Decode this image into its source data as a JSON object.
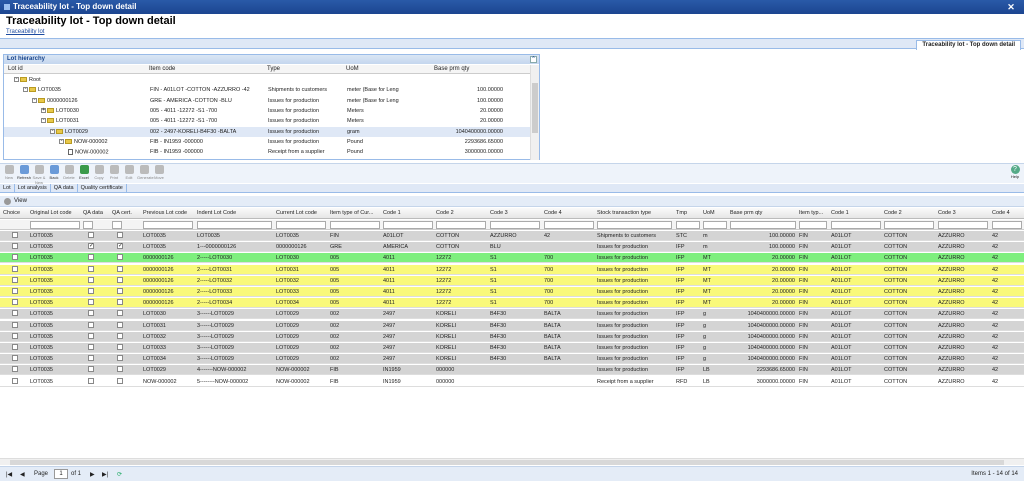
{
  "window": {
    "title": "Traceability lot - Top down detail"
  },
  "page": {
    "title": "Traceability lot - Top down detail",
    "breadcrumb": "Traceability lot",
    "tab": "Traceability lot - Top down detail"
  },
  "lot_hierarchy": {
    "title": "Lot hierarchy",
    "columns": [
      "Lot id",
      "Item code",
      "Type",
      "UoM",
      "Base prm qty"
    ],
    "rows": [
      {
        "indent": 0,
        "expander": "-",
        "kind": "folder",
        "lot": "Root",
        "item": "",
        "type": "",
        "uom": "",
        "qty": ""
      },
      {
        "indent": 1,
        "expander": "-",
        "kind": "folder",
        "lot": "LOT0035",
        "item": "FIN - A01LOT -COTTON -AZZURRO -42",
        "type": "Shipments to customers",
        "uom": "meter (Base for Leng",
        "qty": "100.00000"
      },
      {
        "indent": 2,
        "expander": "-",
        "kind": "folder",
        "lot": "0000000126",
        "item": "GRE - AMERICA -COTTON -BLU",
        "type": "Issues for production",
        "uom": "meter (Base for Leng",
        "qty": "100.00000"
      },
      {
        "indent": 3,
        "expander": "+",
        "kind": "folder",
        "lot": "LOT0030",
        "item": "005 - 4011 -12272 -S1 -700",
        "type": "Issues for production",
        "uom": "Meters",
        "qty": "20.00000"
      },
      {
        "indent": 3,
        "expander": "-",
        "kind": "folder",
        "lot": "LOT0031",
        "item": "005 - 4011 -12272 -S1 -700",
        "type": "Issues for production",
        "uom": "Meters",
        "qty": "20.00000"
      },
      {
        "indent": 4,
        "expander": "-",
        "kind": "folder",
        "lot": "LOT0029",
        "item": "002 - 2497-KORELI-B4F30 -BALTA",
        "type": "Issues for production",
        "uom": "gram",
        "qty": "1040400000.00000",
        "selected": true
      },
      {
        "indent": 5,
        "expander": "-",
        "kind": "folder",
        "lot": "NOW-000002",
        "item": "FIB - IN1959 -000000",
        "type": "Issues for production",
        "uom": "Pound",
        "qty": "2293686.65000"
      },
      {
        "indent": 6,
        "expander": "",
        "kind": "doc",
        "lot": "NOW-000002",
        "item": "FIB - IN1959 -000000",
        "type": "Receipt from a supplier",
        "uom": "Pound",
        "qty": "3000000.00000"
      }
    ]
  },
  "toolbar": {
    "buttons": [
      {
        "label": "New",
        "icon": "new-icon",
        "enabled": false
      },
      {
        "label": "Refresh",
        "icon": "refresh-icon",
        "enabled": true
      },
      {
        "label": "Save & New",
        "icon": "save-new-icon",
        "enabled": false
      },
      {
        "label": "Back",
        "icon": "back-icon",
        "enabled": true
      },
      {
        "label": "Delete",
        "icon": "delete-icon",
        "enabled": false
      },
      {
        "label": "Excel",
        "icon": "excel-icon",
        "enabled": true
      },
      {
        "label": "Copy",
        "icon": "copy-icon",
        "enabled": false
      },
      {
        "label": "Print",
        "icon": "print-icon",
        "enabled": false
      },
      {
        "label": "Edit",
        "icon": "edit-icon",
        "enabled": false
      },
      {
        "label": "Generate",
        "icon": "generate-icon",
        "enabled": false
      },
      {
        "label": "Move",
        "icon": "move-icon",
        "enabled": false
      }
    ],
    "help": "Help"
  },
  "subtabs": [
    "Lot",
    "Lot analysis",
    "QA data",
    "Quality certificate"
  ],
  "viewbar": {
    "label": "View"
  },
  "grid": {
    "columns": [
      "Choice",
      "Original Lot code",
      "QA data",
      "QA cert.",
      "Previous Lot code",
      "Indent Lot Code",
      "Current Lot code",
      "Item type of Cur...",
      "Code 1",
      "Code 2",
      "Code 3",
      "Code 4",
      "Stock transaction type",
      "Tmp",
      "UoM",
      "Base prm qty",
      "Item typ...",
      "Code 1",
      "Code 2",
      "Code 3",
      "Code 4"
    ],
    "rows": [
      {
        "color": "gray",
        "qa": false,
        "cert": false,
        "orig": "LOT0035",
        "prev": "LOT0035",
        "indent": "LOT0035",
        "cur": "LOT0035",
        "itype": "FIN",
        "c1": "A01LOT",
        "c2": "COTTON",
        "c3": "AZZURRO",
        "c4": "42",
        "stt": "Shipments to customers",
        "tmp": "STC",
        "uom": "m",
        "qty": "100.00000",
        "it2": "FIN",
        "d1": "A01LOT",
        "d2": "COTTON",
        "d3": "AZZURRO",
        "d4": "42"
      },
      {
        "color": "gray",
        "qa": true,
        "cert": true,
        "orig": "LOT0035",
        "prev": "LOT0035",
        "indent": "1---0000000126",
        "cur": "0000000126",
        "itype": "GRE",
        "c1": "AMERICA",
        "c2": "COTTON",
        "c3": "BLU",
        "c4": "",
        "stt": "Issues for production",
        "tmp": "IFP",
        "uom": "m",
        "qty": "100.00000",
        "it2": "FIN",
        "d1": "A01LOT",
        "d2": "COTTON",
        "d3": "AZZURRO",
        "d4": "42"
      },
      {
        "color": "green",
        "qa": false,
        "cert": false,
        "orig": "LOT0035",
        "prev": "0000000126",
        "indent": "2-----LOT0030",
        "cur": "LOT0030",
        "itype": "005",
        "c1": "4011",
        "c2": "12272",
        "c3": "S1",
        "c4": "700",
        "stt": "Issues for production",
        "tmp": "IFP",
        "uom": "MT",
        "qty": "20.00000",
        "it2": "FIN",
        "d1": "A01LOT",
        "d2": "COTTON",
        "d3": "AZZURRO",
        "d4": "42"
      },
      {
        "color": "yellow",
        "qa": false,
        "cert": false,
        "orig": "LOT0035",
        "prev": "0000000126",
        "indent": "2-----LOT0031",
        "cur": "LOT0031",
        "itype": "005",
        "c1": "4011",
        "c2": "12272",
        "c3": "S1",
        "c4": "700",
        "stt": "Issues for production",
        "tmp": "IFP",
        "uom": "MT",
        "qty": "20.00000",
        "it2": "FIN",
        "d1": "A01LOT",
        "d2": "COTTON",
        "d3": "AZZURRO",
        "d4": "42"
      },
      {
        "color": "yellow",
        "qa": false,
        "cert": false,
        "orig": "LOT0035",
        "prev": "0000000126",
        "indent": "2-----LOT0032",
        "cur": "LOT0032",
        "itype": "005",
        "c1": "4011",
        "c2": "12272",
        "c3": "S1",
        "c4": "700",
        "stt": "Issues for production",
        "tmp": "IFP",
        "uom": "MT",
        "qty": "20.00000",
        "it2": "FIN",
        "d1": "A01LOT",
        "d2": "COTTON",
        "d3": "AZZURRO",
        "d4": "42"
      },
      {
        "color": "yellow",
        "qa": false,
        "cert": false,
        "orig": "LOT0035",
        "prev": "0000000126",
        "indent": "2-----LOT0033",
        "cur": "LOT0033",
        "itype": "005",
        "c1": "4011",
        "c2": "12272",
        "c3": "S1",
        "c4": "700",
        "stt": "Issues for production",
        "tmp": "IFP",
        "uom": "MT",
        "qty": "20.00000",
        "it2": "FIN",
        "d1": "A01LOT",
        "d2": "COTTON",
        "d3": "AZZURRO",
        "d4": "42"
      },
      {
        "color": "yellow",
        "qa": false,
        "cert": false,
        "orig": "LOT0035",
        "prev": "0000000126",
        "indent": "2-----LOT0034",
        "cur": "LOT0034",
        "itype": "005",
        "c1": "4011",
        "c2": "12272",
        "c3": "S1",
        "c4": "700",
        "stt": "Issues for production",
        "tmp": "IFP",
        "uom": "MT",
        "qty": "20.00000",
        "it2": "FIN",
        "d1": "A01LOT",
        "d2": "COTTON",
        "d3": "AZZURRO",
        "d4": "42"
      },
      {
        "color": "gray",
        "qa": false,
        "cert": false,
        "orig": "LOT0035",
        "prev": "LOT0030",
        "indent": "3------LOT0029",
        "cur": "LOT0029",
        "itype": "002",
        "c1": "2497",
        "c2": "KORELI",
        "c3": "B4F30",
        "c4": "BALTA",
        "stt": "Issues for production",
        "tmp": "IFP",
        "uom": "g",
        "qty": "1040400000.00000",
        "it2": "FIN",
        "d1": "A01LOT",
        "d2": "COTTON",
        "d3": "AZZURRO",
        "d4": "42"
      },
      {
        "color": "gray",
        "qa": false,
        "cert": false,
        "orig": "LOT0035",
        "prev": "LOT0031",
        "indent": "3------LOT0029",
        "cur": "LOT0029",
        "itype": "002",
        "c1": "2497",
        "c2": "KORELI",
        "c3": "B4F30",
        "c4": "BALTA",
        "stt": "Issues for production",
        "tmp": "IFP",
        "uom": "g",
        "qty": "1040400000.00000",
        "it2": "FIN",
        "d1": "A01LOT",
        "d2": "COTTON",
        "d3": "AZZURRO",
        "d4": "42"
      },
      {
        "color": "gray",
        "qa": false,
        "cert": false,
        "orig": "LOT0035",
        "prev": "LOT0032",
        "indent": "3------LOT0029",
        "cur": "LOT0029",
        "itype": "002",
        "c1": "2497",
        "c2": "KORELI",
        "c3": "B4F30",
        "c4": "BALTA",
        "stt": "Issues for production",
        "tmp": "IFP",
        "uom": "g",
        "qty": "1040400000.00000",
        "it2": "FIN",
        "d1": "A01LOT",
        "d2": "COTTON",
        "d3": "AZZURRO",
        "d4": "42"
      },
      {
        "color": "gray",
        "qa": false,
        "cert": false,
        "orig": "LOT0035",
        "prev": "LOT0033",
        "indent": "3------LOT0029",
        "cur": "LOT0029",
        "itype": "002",
        "c1": "2497",
        "c2": "KORELI",
        "c3": "B4F30",
        "c4": "BALTA",
        "stt": "Issues for production",
        "tmp": "IFP",
        "uom": "g",
        "qty": "1040400000.00000",
        "it2": "FIN",
        "d1": "A01LOT",
        "d2": "COTTON",
        "d3": "AZZURRO",
        "d4": "42"
      },
      {
        "color": "gray",
        "qa": false,
        "cert": false,
        "orig": "LOT0035",
        "prev": "LOT0034",
        "indent": "3------LOT0029",
        "cur": "LOT0029",
        "itype": "002",
        "c1": "2497",
        "c2": "KORELI",
        "c3": "B4F30",
        "c4": "BALTA",
        "stt": "Issues for production",
        "tmp": "IFP",
        "uom": "g",
        "qty": "1040400000.00000",
        "it2": "FIN",
        "d1": "A01LOT",
        "d2": "COTTON",
        "d3": "AZZURRO",
        "d4": "42"
      },
      {
        "color": "gray",
        "qa": false,
        "cert": false,
        "orig": "LOT0035",
        "prev": "LOT0029",
        "indent": "4-------NOW-000002",
        "cur": "NOW-000002",
        "itype": "FIB",
        "c1": "IN1959",
        "c2": "000000",
        "c3": "",
        "c4": "",
        "stt": "Issues for production",
        "tmp": "IFP",
        "uom": "LB",
        "qty": "2293686.65000",
        "it2": "FIN",
        "d1": "A01LOT",
        "d2": "COTTON",
        "d3": "AZZURRO",
        "d4": "42"
      },
      {
        "color": "white",
        "qa": false,
        "cert": false,
        "orig": "LOT0035",
        "prev": "NOW-000002",
        "indent": "5--------NOW-000002",
        "cur": "NOW-000002",
        "itype": "FIB",
        "c1": "IN1959",
        "c2": "000000",
        "c3": "",
        "c4": "",
        "stt": "Receipt from a supplier",
        "tmp": "RFD",
        "uom": "LB",
        "qty": "3000000.00000",
        "it2": "FIN",
        "d1": "A01LOT",
        "d2": "COTTON",
        "d3": "AZZURRO",
        "d4": "42"
      }
    ]
  },
  "pager": {
    "page_label": "Page",
    "page": "1",
    "of_label": "of 1",
    "summary": "Items 1 - 14 of 14"
  },
  "colors": {
    "title_bar": "#1c4590",
    "green_row": "#7eef7e",
    "yellow_row": "#f9f97a",
    "gray_row": "#d4d4d4"
  }
}
